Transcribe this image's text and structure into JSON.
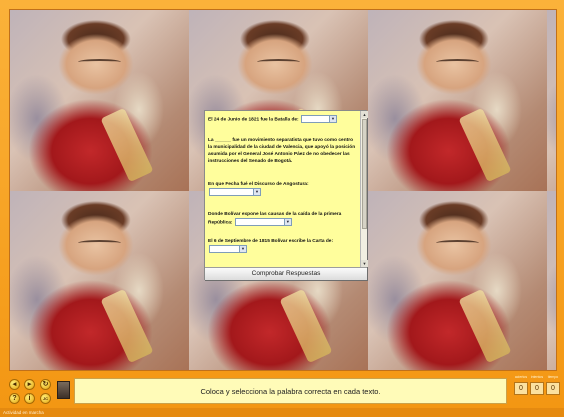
{
  "quiz": {
    "questions": [
      {
        "before": "El 24 de Junio de 1821 fue la Batalla de:",
        "after": "",
        "selected": ""
      },
      {
        "before": "La",
        "after": "fue un movimiento separatista que tuvo como centro la municipalidad de la ciudad de Valencia, que apoyó la posición asumida por el General José Antonio Páez de no obedecer las instrucciones del Senado de Bogotá.",
        "blank": "______"
      },
      {
        "before": "En que Fecha fué el Discurso de Angostura:",
        "after": "",
        "selected": ""
      },
      {
        "before": "Donde Bolívar expone las causas de la caída de la primera República:",
        "after": "",
        "selected": ""
      },
      {
        "before": "El 6 de Septiembre de 1815 Bolívar escribe la Carta de:",
        "after": "",
        "selected": ""
      }
    ],
    "check_button": "Comprobar Respuestas",
    "dropdown_arrow": "▼"
  },
  "toolbar": {
    "message": "Coloca y selecciona la palabra correcta en cada texto.",
    "nav_icons": [
      "arrow-left-icon",
      "arrow-right-icon",
      "help-icon",
      "info-icon",
      "reload-icon",
      "jclic-logo-icon"
    ],
    "counter_labels": [
      "aciertos",
      "intentos",
      "tiempo"
    ],
    "counter_values": [
      "0",
      "0",
      "0"
    ]
  },
  "status": {
    "text": "Actividad en marcha"
  },
  "colors": {
    "frame": "#f7a21a",
    "panel": "#fffe9c",
    "message_bg": "#fffbb8"
  }
}
